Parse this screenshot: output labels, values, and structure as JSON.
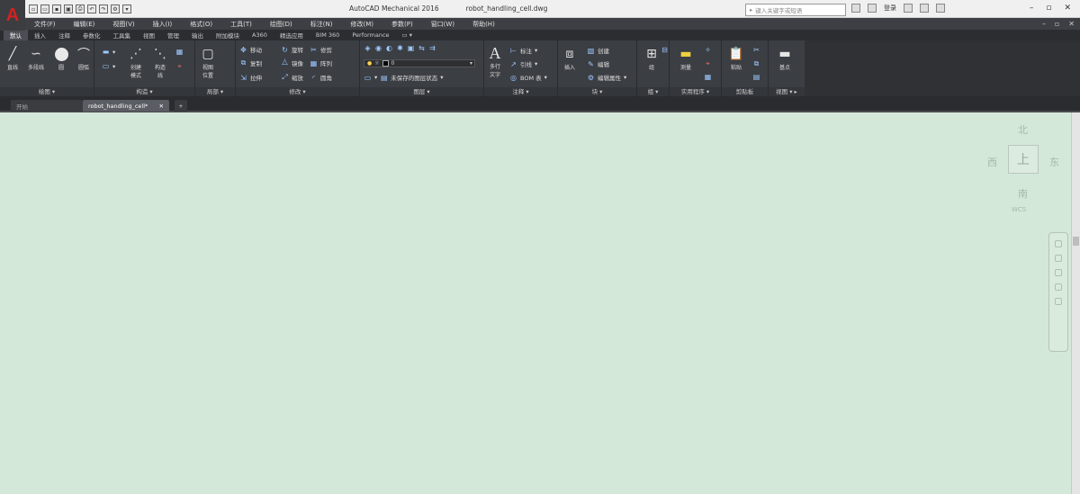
{
  "app": {
    "product_title": "AutoCAD Mechanical 2016",
    "file_title": "robot_handling_cell.dwg",
    "logo": "A",
    "search_placeholder": "键入关键字或短语",
    "signin": "登录",
    "accent": "#d42020"
  },
  "menubar": {
    "items": [
      "文件(F)",
      "编辑(E)",
      "视图(V)",
      "插入(I)",
      "格式(O)",
      "工具(T)",
      "绘图(D)",
      "标注(N)",
      "修改(M)",
      "参数(P)",
      "窗口(W)",
      "帮助(H)"
    ]
  },
  "ribbon_tabs": {
    "items": [
      "默认",
      "插入",
      "注释",
      "参数化",
      "工具集",
      "视图",
      "管理",
      "输出",
      "附加模块",
      "A360",
      "精选应用",
      "BIM 360",
      "Performance"
    ],
    "active": "默认"
  },
  "ribbon": {
    "draw": {
      "label": "绘图",
      "line": "直线",
      "polyline": "多段线",
      "circle": "圆",
      "arc": "圆弧"
    },
    "construct": {
      "label": "构造",
      "tool_a": "创建\n模式",
      "tool_b": "构造\n线"
    },
    "detail": {
      "label": "局部",
      "tool": "视图\n位置"
    },
    "modify": {
      "label": "修改",
      "move": "移动",
      "rotate": "旋转",
      "trim": "修剪",
      "copy": "复制",
      "mirror": "镜像",
      "fillet": "圆角",
      "array": "阵列",
      "stretch": "拉伸",
      "scale": "缩放",
      "extend": "延伸"
    },
    "layers": {
      "label": "图层",
      "layer_value": "0",
      "match": "置为当前",
      "layer_state": "未保存的图层状态"
    },
    "annotation": {
      "label": "注释",
      "text": "多行\n文字",
      "dim": "标注",
      "leader": "引线",
      "bom": "BOM 表"
    },
    "block": {
      "label": "块",
      "insert": "插入",
      "create": "创建",
      "edit": "编辑",
      "edit_attr": "编辑属性"
    },
    "groups": {
      "label": "组",
      "tool": "组"
    },
    "utilities": {
      "label": "实用程序",
      "measure": "测量"
    },
    "clipboard": {
      "label": "剪贴板",
      "paste": "粘贴"
    },
    "view": {
      "label": "视图",
      "base": "基点"
    }
  },
  "doctabs": {
    "start": "开始",
    "current": "robot_handling_cell*",
    "plus": "+"
  },
  "viewcube": {
    "north": "北",
    "south": "南",
    "east": "东",
    "west": "西",
    "face": "上",
    "wcs": "WCS"
  }
}
